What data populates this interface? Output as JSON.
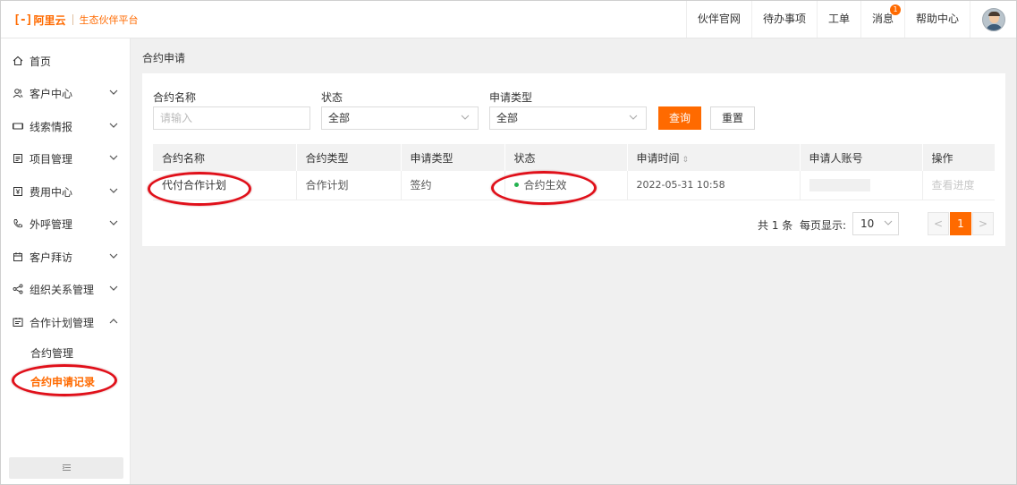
{
  "header": {
    "logo_bracket": "[-]",
    "logo_text": "阿里云",
    "platform": "生态伙伴平台",
    "nav": [
      {
        "label": "伙伴官网"
      },
      {
        "label": "待办事项"
      },
      {
        "label": "工单"
      },
      {
        "label": "消息",
        "badge": "1"
      },
      {
        "label": "帮助中心"
      }
    ]
  },
  "sidebar": {
    "items": [
      {
        "label": "首页",
        "icon": "home-icon"
      },
      {
        "label": "客户中心",
        "icon": "users-icon"
      },
      {
        "label": "线索情报",
        "icon": "leads-icon"
      },
      {
        "label": "项目管理",
        "icon": "project-icon"
      },
      {
        "label": "费用中心",
        "icon": "fee-icon"
      },
      {
        "label": "外呼管理",
        "icon": "phone-icon"
      },
      {
        "label": "客户拜访",
        "icon": "calendar-icon"
      },
      {
        "label": "组织关系管理",
        "icon": "share-icon"
      },
      {
        "label": "合作计划管理",
        "icon": "plan-icon",
        "expanded": true
      }
    ],
    "sub_items": [
      {
        "label": "合约管理"
      },
      {
        "label": "合约申请记录",
        "active": true
      }
    ],
    "collapse_icon": "collapse-icon"
  },
  "breadcrumb": "合约申请",
  "filters": {
    "name_label": "合约名称",
    "name_placeholder": "请输入",
    "status_label": "状态",
    "status_value": "全部",
    "type_label": "申请类型",
    "type_value": "全部",
    "query_label": "查询",
    "reset_label": "重置"
  },
  "table": {
    "columns": [
      "合约名称",
      "合约类型",
      "申请类型",
      "状态",
      "申请时间",
      "申请人账号",
      "操作"
    ],
    "rows": [
      {
        "name": "代付合作计划",
        "contract_type": "合作计划",
        "apply_type": "签约",
        "status": "合约生效",
        "time": "2022-05-31 10:58",
        "account": "",
        "action": "查看进度"
      }
    ]
  },
  "pagination": {
    "total": "共 1 条",
    "page_size_label": "每页显示:",
    "page_size": "10",
    "current_page": "1"
  },
  "colors": {
    "accent": "#ff6a00",
    "status_ok": "#24b250",
    "annotation": "#e0101a"
  }
}
